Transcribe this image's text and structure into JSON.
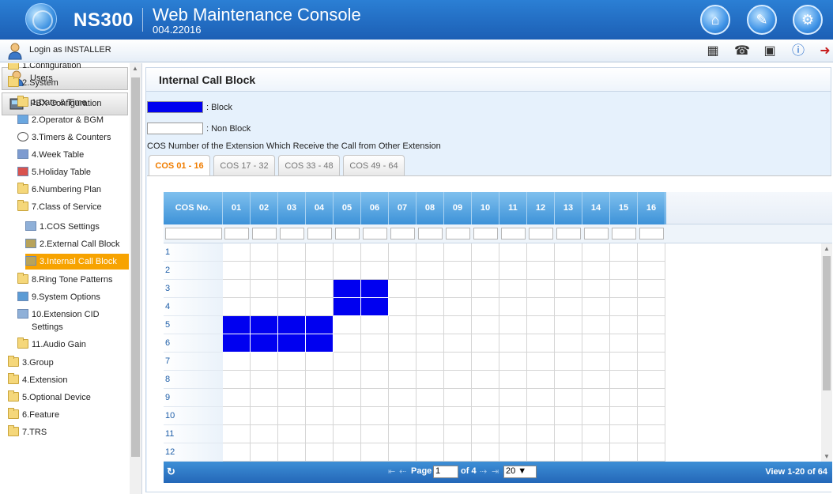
{
  "header": {
    "product": "NS300",
    "title": "Web Maintenance Console",
    "version": "004.22016",
    "buttons": [
      {
        "name": "home-icon",
        "glyph": "⌂"
      },
      {
        "name": "tools-icon",
        "glyph": "✎"
      },
      {
        "name": "settings-icon",
        "glyph": "⚙"
      }
    ]
  },
  "subbar": {
    "login": "Login as INSTALLER",
    "tools": [
      {
        "name": "calendar-icon",
        "glyph": "▦"
      },
      {
        "name": "phone-icon",
        "glyph": "☎"
      },
      {
        "name": "save-icon",
        "glyph": "▣"
      },
      {
        "name": "info-icon",
        "glyph": "ⓘ"
      },
      {
        "name": "logout-icon",
        "glyph": "➜"
      }
    ]
  },
  "sidebar": {
    "panels": [
      "Users",
      "PBX Configuration"
    ],
    "items": [
      {
        "label": "1.Configuration",
        "level": 0,
        "icon": "folder-icon"
      },
      {
        "label": "2.System",
        "level": 0,
        "icon": "folder-open-icon"
      },
      {
        "label": "1.Date & Time",
        "level": 1,
        "icon": "folder-icon"
      },
      {
        "label": "2.Operator & BGM",
        "level": 1,
        "icon": "operator-icon"
      },
      {
        "label": "3.Timers & Counters",
        "level": 1,
        "icon": "clock-icon"
      },
      {
        "label": "4.Week Table",
        "level": 1,
        "icon": "table-icon"
      },
      {
        "label": "5.Holiday Table",
        "level": 1,
        "icon": "calendar-icon"
      },
      {
        "label": "6.Numbering Plan",
        "level": 1,
        "icon": "folder-icon"
      },
      {
        "label": "7.Class of Service",
        "level": 1,
        "icon": "folder-open-icon"
      },
      {
        "label": "1.COS Settings",
        "level": 2,
        "icon": "settings-doc-icon"
      },
      {
        "label": "2.External Call Block",
        "level": 2,
        "icon": "block-icon"
      },
      {
        "label": "3.Internal Call Block",
        "level": 2,
        "icon": "block-icon",
        "selected": true
      },
      {
        "label": "8.Ring Tone Patterns",
        "level": 1,
        "icon": "folder-icon"
      },
      {
        "label": "9.System Options",
        "level": 1,
        "icon": "options-icon"
      },
      {
        "label": "10.Extension CID",
        "label2": "Settings",
        "level": 1,
        "icon": "doc-icon"
      },
      {
        "label": "11.Audio Gain",
        "level": 1,
        "icon": "folder-icon"
      },
      {
        "label": "3.Group",
        "level": 0,
        "icon": "folder-icon"
      },
      {
        "label": "4.Extension",
        "level": 0,
        "icon": "folder-icon"
      },
      {
        "label": "5.Optional Device",
        "level": 0,
        "icon": "folder-icon"
      },
      {
        "label": "6.Feature",
        "level": 0,
        "icon": "folder-icon"
      },
      {
        "label": "7.TRS",
        "level": 0,
        "icon": "folder-icon"
      }
    ]
  },
  "main": {
    "title": "Internal Call Block",
    "legend": {
      "block": ": Block",
      "nonblock": ": Non Block",
      "block_color": "#0000f0"
    },
    "caption": "COS Number of the Extension Which Receive the Call from Other Extension",
    "tabs": [
      "COS 01 - 16",
      "COS 17 - 32",
      "COS 33 - 48",
      "COS 49 - 64"
    ],
    "active_tab": 0,
    "grid": {
      "corner": "COS No.",
      "columns": [
        "01",
        "02",
        "03",
        "04",
        "05",
        "06",
        "07",
        "08",
        "09",
        "10",
        "11",
        "12",
        "13",
        "14",
        "15",
        "16"
      ],
      "rows": [
        "1",
        "2",
        "3",
        "4",
        "5",
        "6",
        "7",
        "8",
        "9",
        "10",
        "11",
        "12"
      ],
      "blocked": [
        [
          2,
          4
        ],
        [
          2,
          5
        ],
        [
          3,
          4
        ],
        [
          3,
          5
        ],
        [
          4,
          0
        ],
        [
          4,
          1
        ],
        [
          4,
          2
        ],
        [
          4,
          3
        ],
        [
          5,
          0
        ],
        [
          5,
          1
        ],
        [
          5,
          2
        ],
        [
          5,
          3
        ]
      ]
    },
    "pager": {
      "page_label": "Page",
      "page_value": "1",
      "of_label": "of 4",
      "per_page": "20 ▼",
      "view": "View 1-20 of 64"
    }
  }
}
